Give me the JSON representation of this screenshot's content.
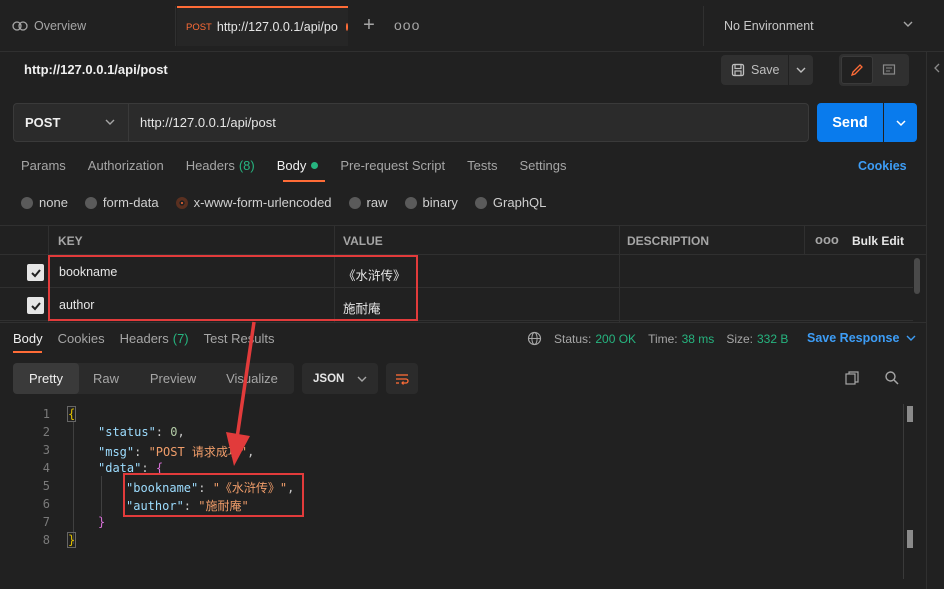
{
  "tabs": {
    "overview_label": "Overview",
    "active": {
      "method": "POST",
      "label": "http://127.0.0.1/api/po"
    },
    "more": "ooo",
    "environment": "No Environment"
  },
  "request": {
    "title": "http://127.0.0.1/api/post",
    "save_label": "Save",
    "method": "POST",
    "url": "http://127.0.0.1/api/post",
    "send_label": "Send"
  },
  "request_tabs": {
    "params": "Params",
    "authorization": "Authorization",
    "headers": "Headers",
    "headers_count": "(8)",
    "body": "Body",
    "pre_request": "Pre-request Script",
    "tests": "Tests",
    "settings": "Settings",
    "cookies": "Cookies"
  },
  "body_types": {
    "none": "none",
    "form_data": "form-data",
    "urlencoded": "x-www-form-urlencoded",
    "raw": "raw",
    "binary": "binary",
    "graphql": "GraphQL"
  },
  "params_table": {
    "headers": {
      "key": "KEY",
      "value": "VALUE",
      "description": "DESCRIPTION",
      "more": "ooo",
      "bulk_edit": "Bulk Edit"
    },
    "rows": [
      {
        "key": "bookname",
        "value": "《水浒传》",
        "checked": true
      },
      {
        "key": "author",
        "value": "施耐庵",
        "checked": true
      }
    ]
  },
  "response_tabs": {
    "body": "Body",
    "cookies": "Cookies",
    "headers": "Headers",
    "headers_count": "(7)",
    "test_results": "Test Results"
  },
  "response_status": {
    "status_label": "Status:",
    "status_value": "200 OK",
    "time_label": "Time:",
    "time_value": "38 ms",
    "size_label": "Size:",
    "size_value": "332 B",
    "save_response": "Save Response"
  },
  "view_modes": {
    "pretty": "Pretty",
    "raw": "Raw",
    "preview": "Preview",
    "visualize": "Visualize",
    "format": "JSON"
  },
  "code": {
    "line_numbers": [
      "1",
      "2",
      "3",
      "4",
      "5",
      "6",
      "7",
      "8"
    ],
    "open_brace": "{",
    "status_key": "\"status\"",
    "status_val": "0",
    "msg_key": "\"msg\"",
    "msg_val": "\"POST 请求成功\"",
    "data_key": "\"data\"",
    "bookname_key": "\"bookname\"",
    "bookname_val": "\"《水浒传》\"",
    "author_key": "\"author\"",
    "author_val": "\"施耐庵\"",
    "inner_close": "}",
    "close_brace": "}"
  },
  "colors": {
    "accent_orange": "#ff6c37",
    "send_blue": "#097bed",
    "success_green": "#26b47f",
    "annotation_red": "#e23b3b"
  }
}
